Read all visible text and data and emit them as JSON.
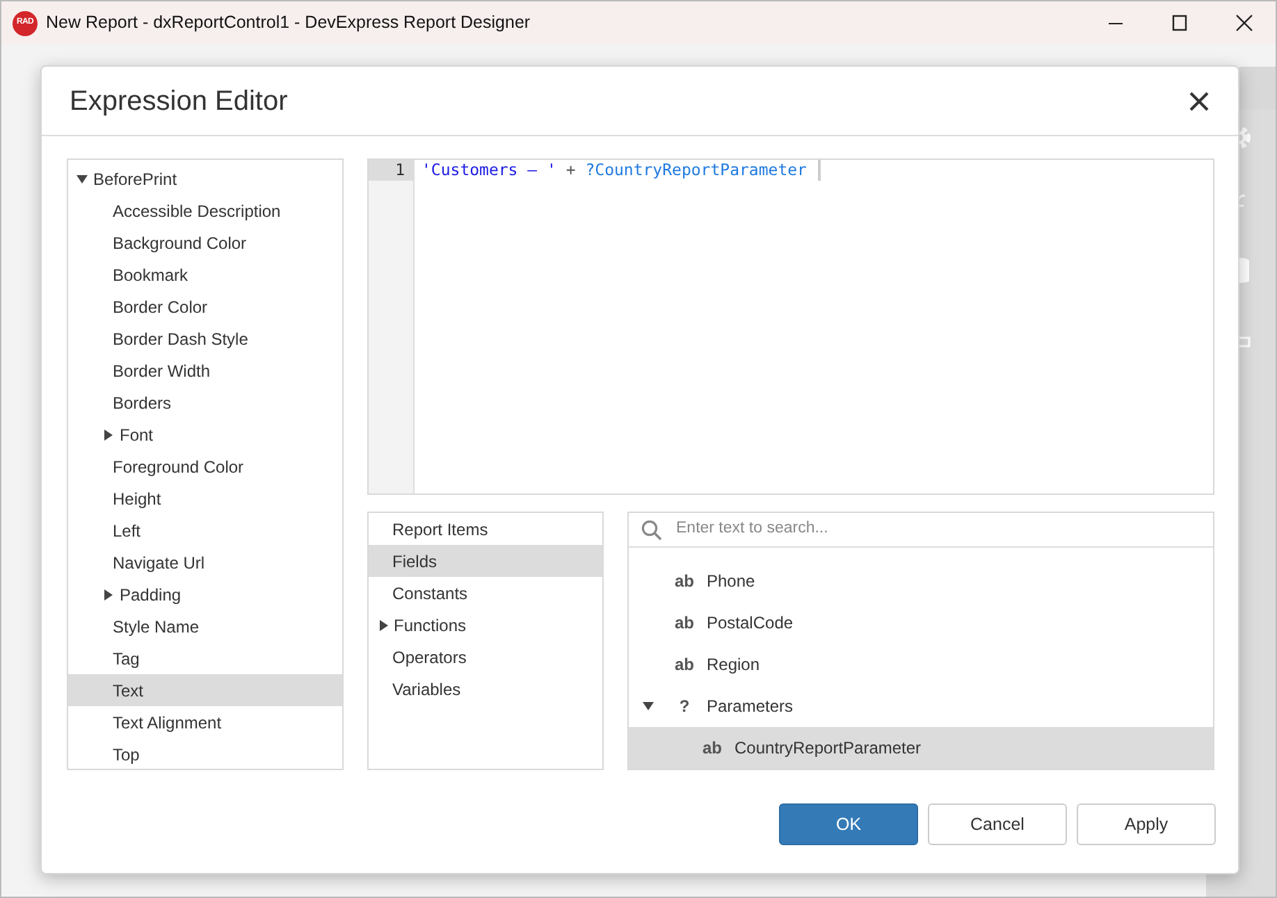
{
  "window": {
    "app_icon_text": "RAD",
    "title": "New Report - dxReportControl1 - DevExpress Report Designer"
  },
  "dialog": {
    "title": "Expression Editor",
    "properties": [
      {
        "label": "BeforePrint",
        "kind": "group",
        "expanded": true,
        "selected": false,
        "children": [
          {
            "label": "Accessible Description",
            "kind": "property",
            "selected": false
          },
          {
            "label": "Background Color",
            "kind": "property",
            "selected": false
          },
          {
            "label": "Bookmark",
            "kind": "property",
            "selected": false
          },
          {
            "label": "Border Color",
            "kind": "property",
            "selected": false
          },
          {
            "label": "Border Dash Style",
            "kind": "property",
            "selected": false
          },
          {
            "label": "Border Width",
            "kind": "property",
            "selected": false
          },
          {
            "label": "Borders",
            "kind": "property",
            "selected": false
          },
          {
            "label": "Font",
            "kind": "group",
            "expanded": false,
            "selected": false
          },
          {
            "label": "Foreground Color",
            "kind": "property",
            "selected": false
          },
          {
            "label": "Height",
            "kind": "property",
            "selected": false
          },
          {
            "label": "Left",
            "kind": "property",
            "selected": false
          },
          {
            "label": "Navigate Url",
            "kind": "property",
            "selected": false
          },
          {
            "label": "Padding",
            "kind": "group",
            "expanded": false,
            "selected": false
          },
          {
            "label": "Style Name",
            "kind": "property",
            "selected": false
          },
          {
            "label": "Tag",
            "kind": "property",
            "selected": false
          },
          {
            "label": "Text",
            "kind": "property",
            "selected": true
          },
          {
            "label": "Text Alignment",
            "kind": "property",
            "selected": false
          },
          {
            "label": "Top",
            "kind": "property",
            "selected": false
          }
        ]
      }
    ],
    "editor": {
      "lines": [
        {
          "number": "1",
          "tokens": [
            {
              "kind": "string",
              "text": "'Customers – '"
            },
            {
              "kind": "operator",
              "text": "+"
            },
            {
              "kind": "parameter",
              "text": "?CountryReportParameter"
            }
          ]
        }
      ]
    },
    "categories": [
      {
        "label": "Report Items",
        "kind": "item",
        "selected": false
      },
      {
        "label": "Fields",
        "kind": "item",
        "selected": true
      },
      {
        "label": "Constants",
        "kind": "item",
        "selected": false
      },
      {
        "label": "Functions",
        "kind": "group",
        "expanded": false,
        "selected": false
      },
      {
        "label": "Operators",
        "kind": "item",
        "selected": false
      },
      {
        "label": "Variables",
        "kind": "item",
        "selected": false
      }
    ],
    "search": {
      "placeholder": "Enter text to search..."
    },
    "fields": [
      {
        "type_glyph": "ab",
        "label": "Phone",
        "kind": "item",
        "selected": false
      },
      {
        "type_glyph": "ab",
        "label": "PostalCode",
        "kind": "item",
        "selected": false
      },
      {
        "type_glyph": "ab",
        "label": "Region",
        "kind": "item",
        "selected": false
      },
      {
        "type_glyph": "?",
        "label": "Parameters",
        "kind": "group",
        "expanded": true,
        "selected": false,
        "children": [
          {
            "type_glyph": "ab",
            "label": "CountryReportParameter",
            "kind": "item",
            "selected": true
          }
        ]
      }
    ],
    "buttons": [
      {
        "label": "OK",
        "kind": "primary"
      },
      {
        "label": "Cancel",
        "kind": "default"
      },
      {
        "label": "Apply",
        "kind": "default"
      }
    ]
  }
}
